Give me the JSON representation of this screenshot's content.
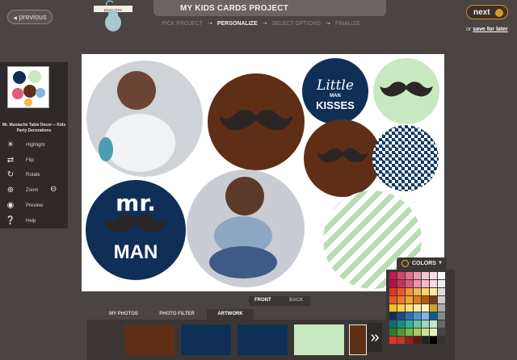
{
  "nav": {
    "previous_label": "previous",
    "next_label": "next",
    "save_prefix": "or",
    "save_link": "save for later"
  },
  "brand": {
    "logo_text": "pear tree"
  },
  "project": {
    "title": "MY KIDS CARDS PROJECT"
  },
  "steps": [
    {
      "label": "PICK PROJECT"
    },
    {
      "label": "PERSONALIZE"
    },
    {
      "label": "SELECT OPTIONS"
    },
    {
      "label": "FINALIZE"
    }
  ],
  "product": {
    "name": "Mr. Mustache Table Decor -- Kids Party Decorations"
  },
  "tools": [
    {
      "label": "Highlight",
      "icon": "sun-icon"
    },
    {
      "label": "Flip",
      "icon": "flip-icon"
    },
    {
      "label": "Rotate",
      "icon": "rotate-icon"
    },
    {
      "label": "Zoom",
      "icon": "zoom-icon"
    },
    {
      "label": "Preview",
      "icon": "eye-icon"
    },
    {
      "label": "Help",
      "icon": "help-icon"
    }
  ],
  "canvas": {
    "little_line1": "Little",
    "little_line2": "MAN",
    "little_line3": "KISSES",
    "mr_line1": "mr.",
    "mr_line2": "MAN"
  },
  "side_tabs": {
    "front": "FRONT",
    "back": "BACK"
  },
  "bottom_tabs": {
    "photos": "MY PHOTOS",
    "filter": "PHOTO FILTER",
    "artwork": "ARTWORK"
  },
  "colors_panel": {
    "label": "COLORS"
  },
  "colors": {
    "brown": "#5e2f16",
    "navy": "#0f2f57",
    "mint": "#c7e8c1",
    "houndstooth": "#123a63",
    "stripe": "#b8dcb4"
  },
  "palette": [
    "#c21a4f",
    "#d8436c",
    "#e26d8e",
    "#eb9ab0",
    "#f3c6d3",
    "#f7dee5",
    "#ffffff",
    "#b2124a",
    "#cf2d5f",
    "#e0577d",
    "#f08fa7",
    "#f5b9c8",
    "#f9d9e2",
    "#eeeeee",
    "#d93a1d",
    "#ea5b2a",
    "#f5913a",
    "#f9b44f",
    "#fbd46b",
    "#fde79c",
    "#dddddd",
    "#e85a1d",
    "#f17b28",
    "#f6a335",
    "#e07b19",
    "#b85b12",
    "#7a3b10",
    "#cccccc",
    "#f1c21b",
    "#f6d24a",
    "#f9e07a",
    "#fbea9f",
    "#fdf2c4",
    "#c8a52e",
    "#aaaaaa",
    "#0e2d5c",
    "#1a4b8c",
    "#2f6db3",
    "#4f93d1",
    "#7fb6e2",
    "#0b5e8e",
    "#888888",
    "#0d6d73",
    "#198e86",
    "#37ad9a",
    "#6bc5a7",
    "#9cd8b9",
    "#c2e7cf",
    "#666666",
    "#2f7a2a",
    "#4f9a37",
    "#79b84a",
    "#a5cf62",
    "#cbe38d",
    "#e5f0b7",
    "#444444",
    "#e33229",
    "#c0392b",
    "#8e2318",
    "#5a1a12",
    "#222222",
    "#000000",
    "#333333"
  ],
  "artwork_swatches": [
    "#5e2f16",
    "#0f2f57",
    "#0f2f57",
    "#c7e8c1",
    "#5e2f16"
  ]
}
